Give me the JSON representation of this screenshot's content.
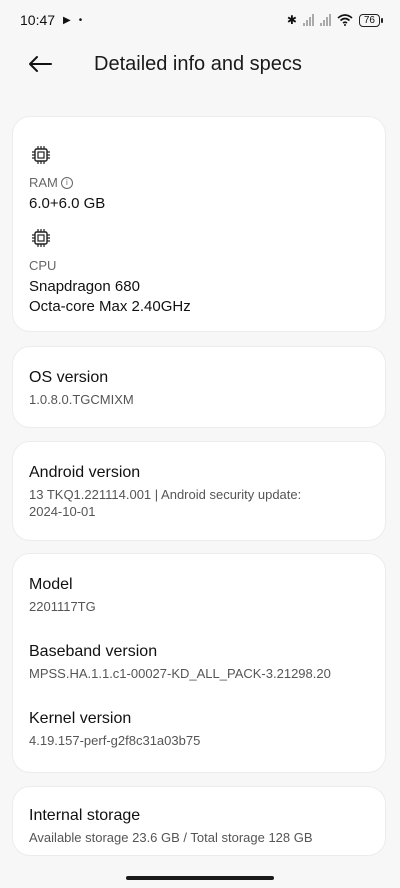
{
  "status_bar": {
    "time": "10:47",
    "battery": "76"
  },
  "header": {
    "title": "Detailed info and specs"
  },
  "hardware": {
    "ram_label": "RAM",
    "ram_value": "6.0+6.0 GB",
    "cpu_label": "CPU",
    "cpu_line1": "Snapdragon 680",
    "cpu_line2": "Octa-core Max 2.40GHz"
  },
  "os": {
    "title": "OS version",
    "value": "1.0.8.0.TGCMIXM"
  },
  "android": {
    "title": "Android version",
    "value_line1": "13 TKQ1.221114.001 | Android security update:",
    "value_line2": "2024-10-01"
  },
  "device": {
    "model_title": "Model",
    "model_value": "2201117TG",
    "baseband_title": "Baseband version",
    "baseband_value": "MPSS.HA.1.1.c1-00027-KD_ALL_PACK-3.21298.20",
    "kernel_title": "Kernel version",
    "kernel_value": "4.19.157-perf-g2f8c31a03b75"
  },
  "storage": {
    "title": "Internal storage",
    "value": "Available storage  23.6 GB / Total storage  128 GB"
  }
}
